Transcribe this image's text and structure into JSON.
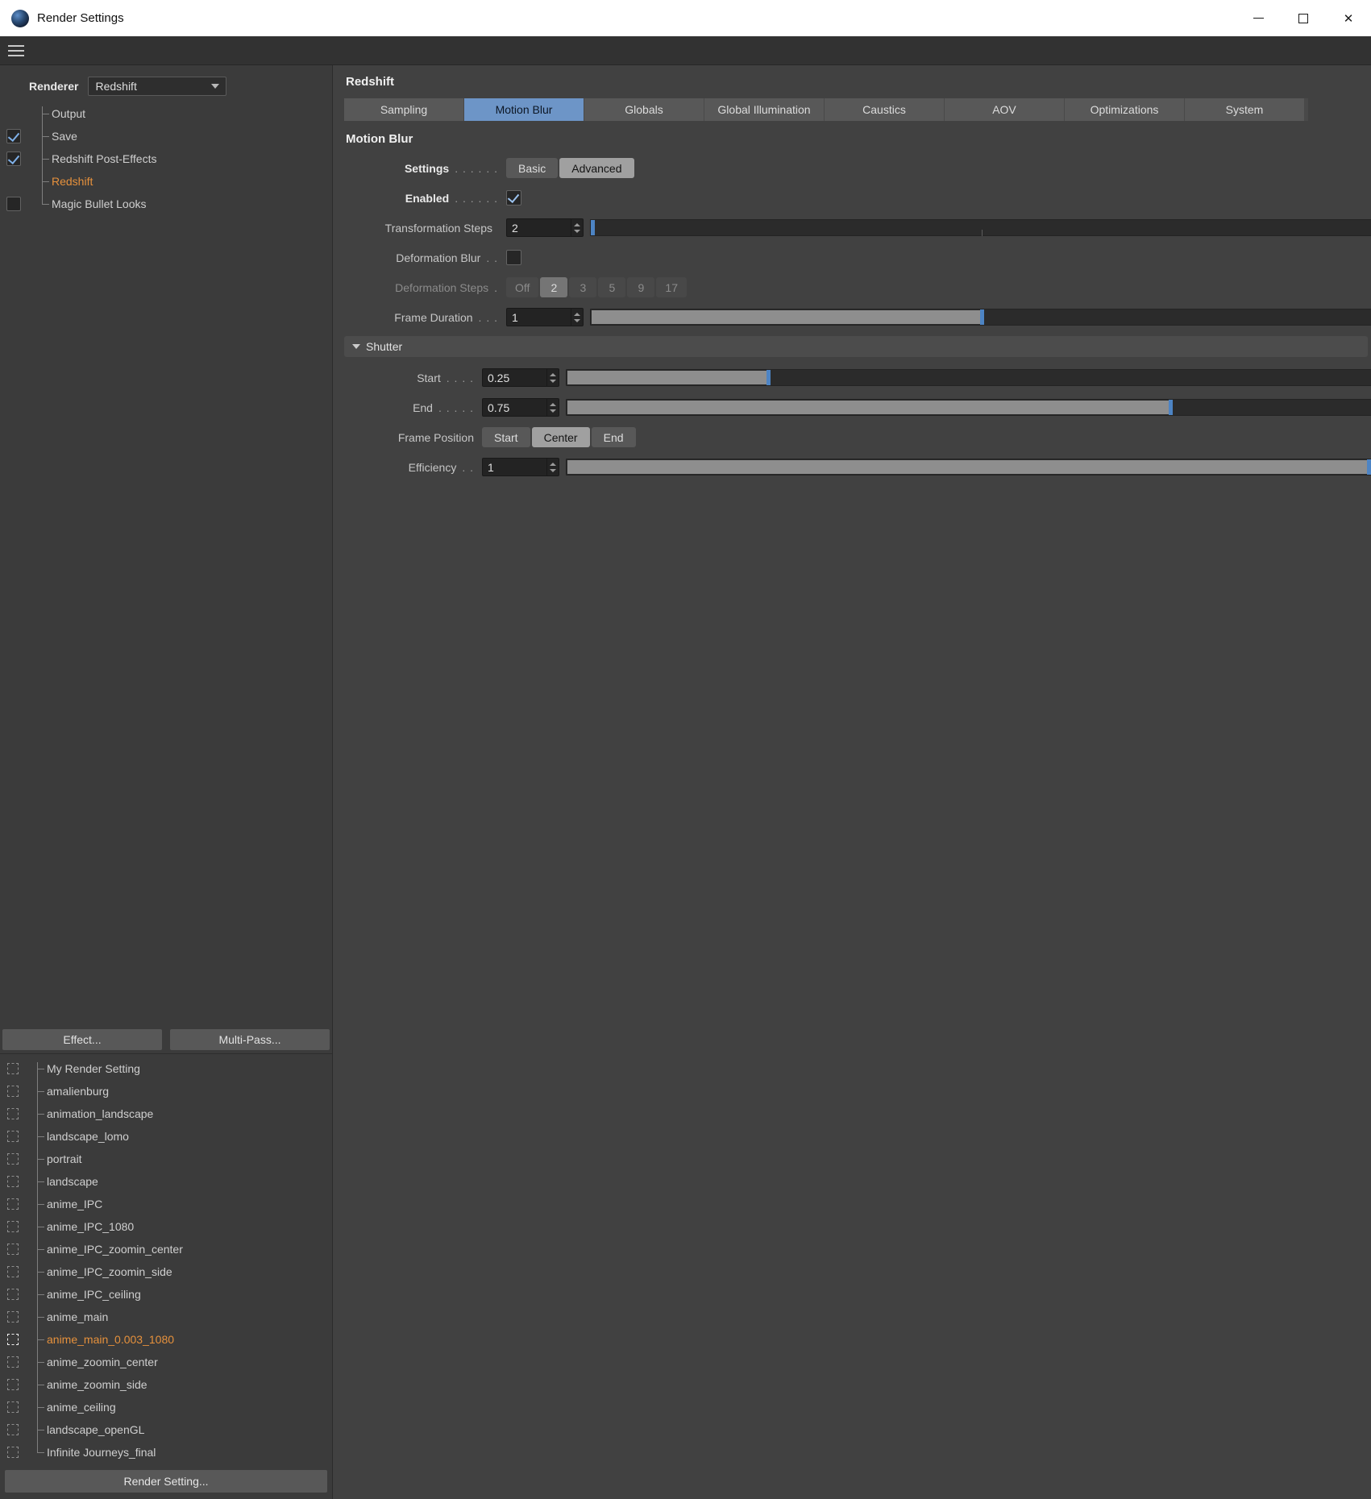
{
  "window": {
    "title": "Render Settings",
    "close_icon": "✕"
  },
  "sidebar": {
    "renderer_label": "Renderer",
    "renderer_value": "Redshift",
    "tree": [
      {
        "label": "Output"
      },
      {
        "label": "Save"
      },
      {
        "label": "Redshift Post-Effects"
      },
      {
        "label": "Redshift"
      },
      {
        "label": "Magic Bullet Looks"
      }
    ],
    "effect_button": "Effect...",
    "multipass_button": "Multi-Pass...",
    "presets": [
      {
        "name": "My Render Setting"
      },
      {
        "name": "amalienburg"
      },
      {
        "name": "animation_landscape"
      },
      {
        "name": "landscape_lomo"
      },
      {
        "name": "portrait"
      },
      {
        "name": "landscape"
      },
      {
        "name": "anime_IPC"
      },
      {
        "name": "anime_IPC_1080"
      },
      {
        "name": "anime_IPC_zoomin_center"
      },
      {
        "name": "anime_IPC_zoomin_side"
      },
      {
        "name": "anime_IPC_ceiling"
      },
      {
        "name": "anime_main"
      },
      {
        "name": "anime_main_0.003_1080"
      },
      {
        "name": "anime_zoomin_center"
      },
      {
        "name": "anime_zoomin_side"
      },
      {
        "name": "anime_ceiling"
      },
      {
        "name": "landscape_openGL"
      },
      {
        "name": "Infinite Journeys_final"
      }
    ],
    "render_setting_button": "Render Setting..."
  },
  "main": {
    "heading": "Redshift",
    "tabs": [
      {
        "label": "Sampling"
      },
      {
        "label": "Motion Blur"
      },
      {
        "label": "Globals"
      },
      {
        "label": "Global Illumination"
      },
      {
        "label": "Caustics"
      },
      {
        "label": "AOV"
      },
      {
        "label": "Optimizations"
      },
      {
        "label": "System"
      }
    ],
    "section_title": "Motion Blur",
    "settings": {
      "label": "Settings",
      "dots": ". . . . . .",
      "basic": "Basic",
      "advanced": "Advanced"
    },
    "enabled": {
      "label": "Enabled",
      "dots": ". . . . . ."
    },
    "transformation_steps": {
      "label": "Transformation Steps",
      "dots": "",
      "value": "2"
    },
    "deformation_blur": {
      "label": "Deformation Blur",
      "dots": ". ."
    },
    "deformation_steps": {
      "label": "Deformation Steps",
      "dots": ".",
      "options": [
        "Off",
        "2",
        "3",
        "5",
        "9",
        "17"
      ],
      "selected": "2"
    },
    "frame_duration": {
      "label": "Frame Duration",
      "dots": ". . .",
      "value": "1"
    },
    "shutter": {
      "label": "Shutter"
    },
    "start": {
      "label": "Start",
      "dots": ". . . .",
      "value": "0.25"
    },
    "end": {
      "label": "End",
      "dots": ". . . . .",
      "value": "0.75"
    },
    "frame_position": {
      "label": "Frame Position",
      "options": [
        "Start",
        "Center",
        "End"
      ],
      "selected": "Center"
    },
    "efficiency": {
      "label": "Efficiency",
      "dots": ". .",
      "value": "1"
    }
  },
  "colors": {
    "accent_orange": "#e6913c",
    "tab_selected": "#6d95c7",
    "slider_handle": "#4d84c4"
  }
}
